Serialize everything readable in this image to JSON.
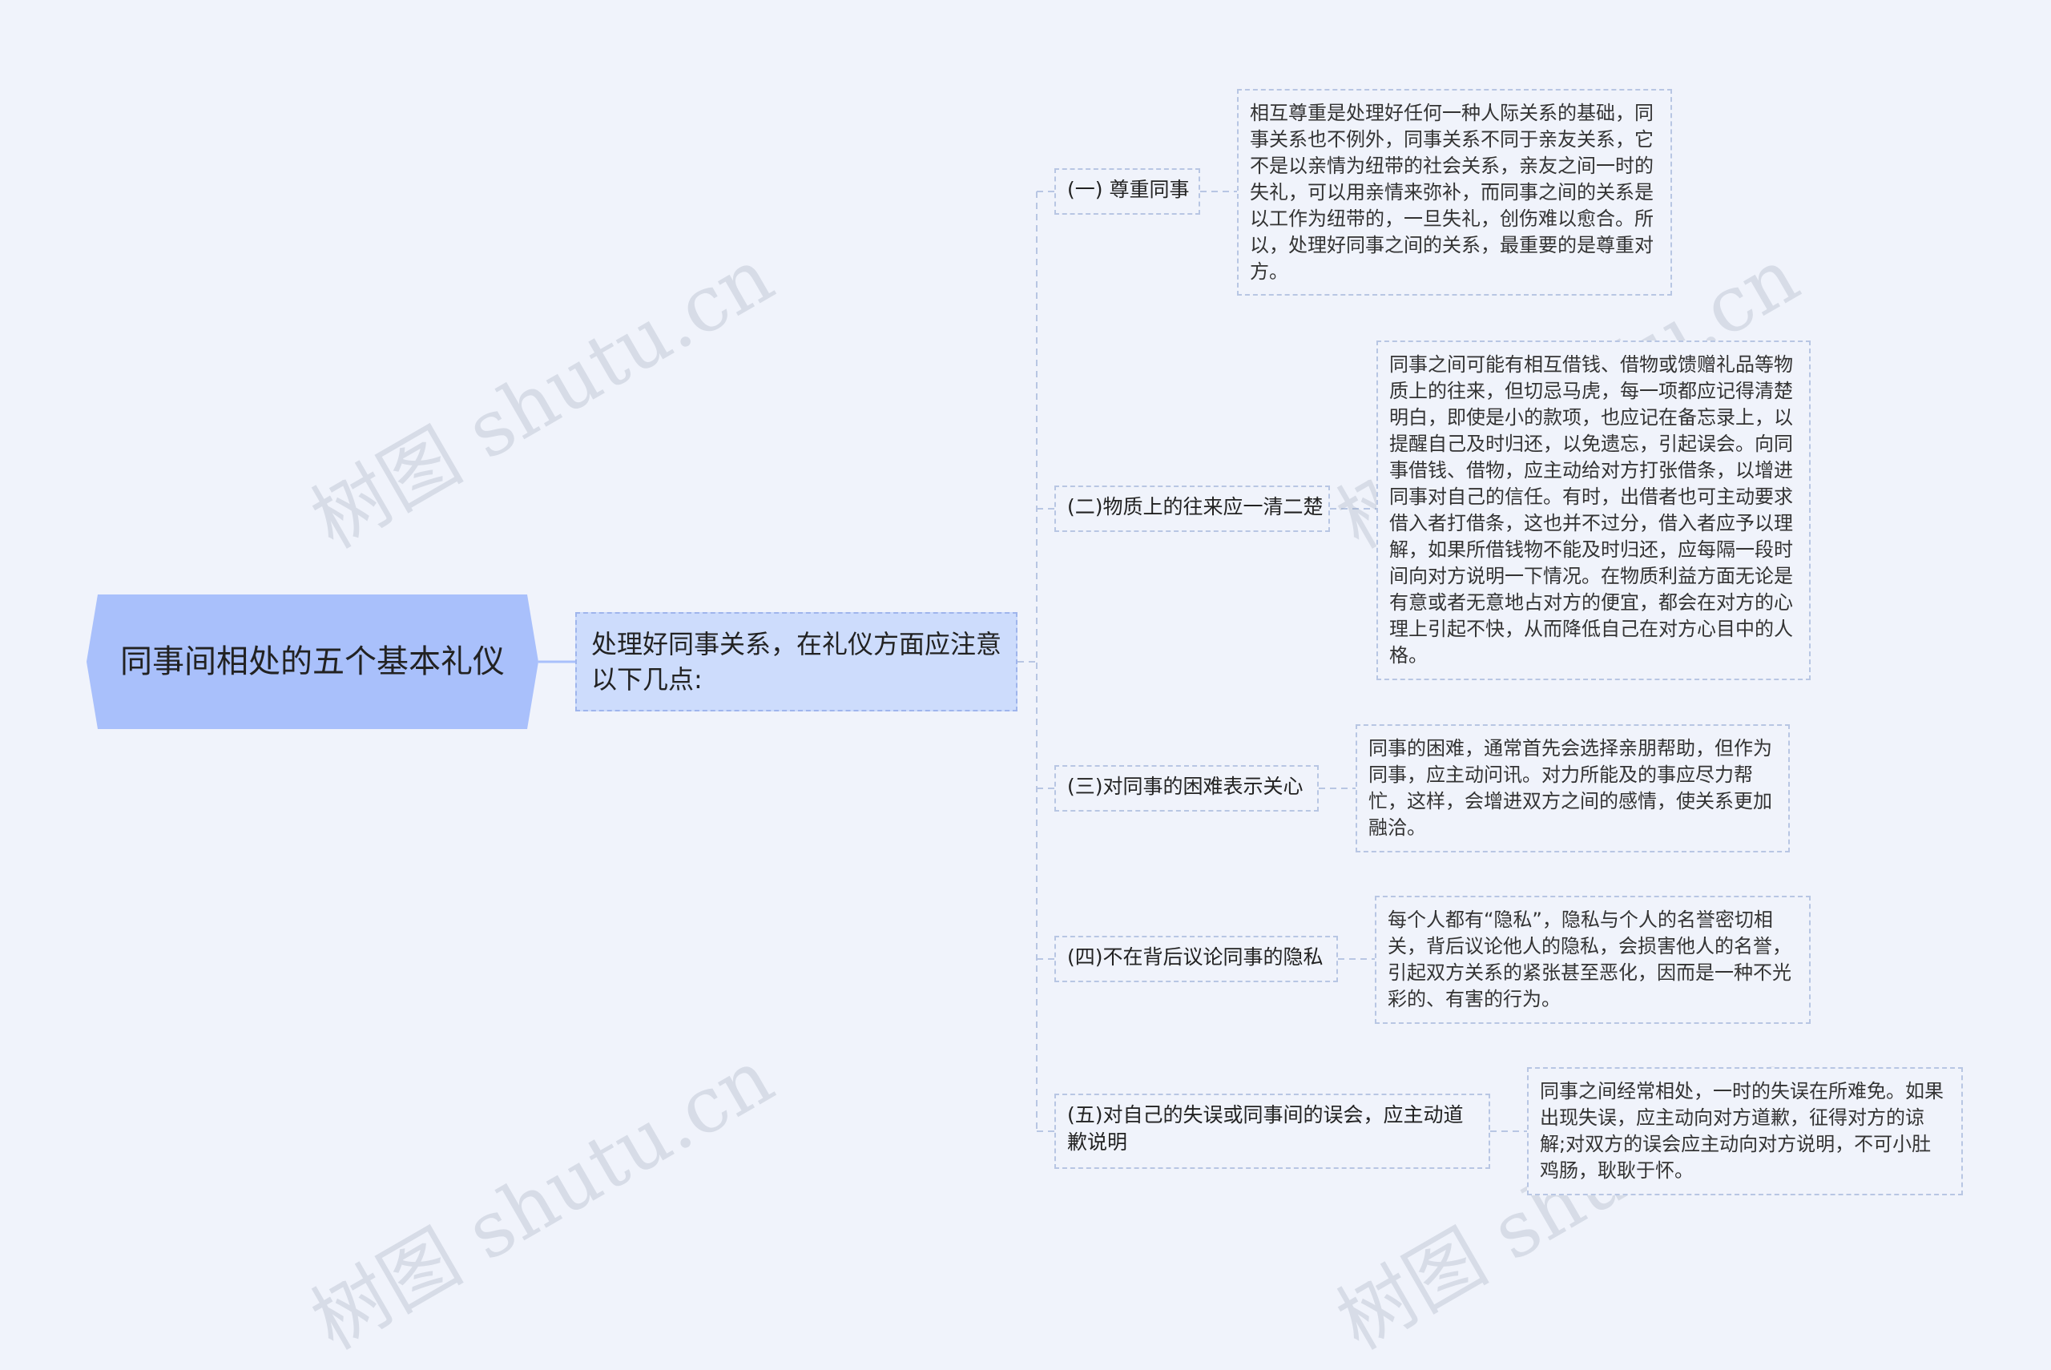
{
  "root": {
    "title": "同事间相处的五个基本礼仪"
  },
  "main": {
    "text": "处理好同事关系，在礼仪方面应注意以下几点:"
  },
  "branches": [
    {
      "label": "(一) 尊重同事",
      "detail": "相互尊重是处理好任何一种人际关系的基础，同事关系也不例外，同事关系不同于亲友关系，它不是以亲情为纽带的社会关系，亲友之间一时的失礼，可以用亲情来弥补，而同事之间的关系是以工作为纽带的，一旦失礼，创伤难以愈合。所以，处理好同事之间的关系，最重要的是尊重对方。"
    },
    {
      "label": "(二)物质上的往来应一清二楚",
      "detail": "同事之间可能有相互借钱、借物或馈赠礼品等物质上的往来，但切忌马虎，每一项都应记得清楚明白，即使是小的款项，也应记在备忘录上，以提醒自己及时归还，以免遗忘，引起误会。向同事借钱、借物，应主动给对方打张借条，以增进同事对自己的信任。有时，出借者也可主动要求借入者打借条，这也并不过分，借入者应予以理解，如果所借钱物不能及时归还，应每隔一段时间向对方说明一下情况。在物质利益方面无论是有意或者无意地占对方的便宜，都会在对方的心理上引起不快，从而降低自己在对方心目中的人格。"
    },
    {
      "label": "(三)对同事的困难表示关心",
      "detail": "同事的困难，通常首先会选择亲朋帮助，但作为同事，应主动问讯。对力所能及的事应尽力帮忙，这样，会增进双方之间的感情，使关系更加融洽。"
    },
    {
      "label": "(四)不在背后议论同事的隐私",
      "detail": "每个人都有“隐私”，隐私与个人的名誉密切相关，背后议论他人的隐私，会损害他人的名誉，引起双方关系的紧张甚至恶化，因而是一种不光彩的、有害的行为。"
    },
    {
      "label": "(五)对自己的失误或同事间的误会，应主动道歉说明",
      "detail": "同事之间经常相处，一时的失误在所难免。如果出现失误，应主动向对方道歉，征得对方的谅解;对双方的误会应主动向对方说明，不可小肚鸡肠，耿耿于怀。"
    }
  ],
  "watermark": "树图 shutu.cn",
  "colors": {
    "background": "#f0f3fb",
    "root": "#a9c0fb",
    "main": "#cddcfc",
    "line": "#b8c6e3"
  }
}
